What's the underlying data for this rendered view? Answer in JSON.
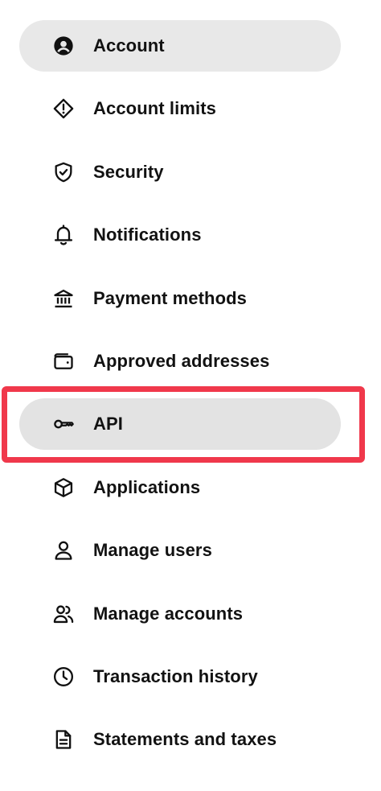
{
  "nav": {
    "items": [
      {
        "label": "Account",
        "icon": "user-circle-icon"
      },
      {
        "label": "Account limits",
        "icon": "alert-diamond-icon"
      },
      {
        "label": "Security",
        "icon": "shield-check-icon"
      },
      {
        "label": "Notifications",
        "icon": "bell-icon"
      },
      {
        "label": "Payment methods",
        "icon": "bank-icon"
      },
      {
        "label": "Approved addresses",
        "icon": "wallet-icon"
      },
      {
        "label": "API",
        "icon": "key-icon"
      },
      {
        "label": "Applications",
        "icon": "cube-icon"
      },
      {
        "label": "Manage users",
        "icon": "user-icon"
      },
      {
        "label": "Manage accounts",
        "icon": "users-icon"
      },
      {
        "label": "Transaction history",
        "icon": "clock-icon"
      },
      {
        "label": "Statements and taxes",
        "icon": "document-icon"
      }
    ],
    "active_item": "Account",
    "highlighted_item": "API"
  },
  "colors": {
    "active_bg": "#e8e8e8",
    "highlight_border": "#f0384b",
    "text": "#121212"
  }
}
